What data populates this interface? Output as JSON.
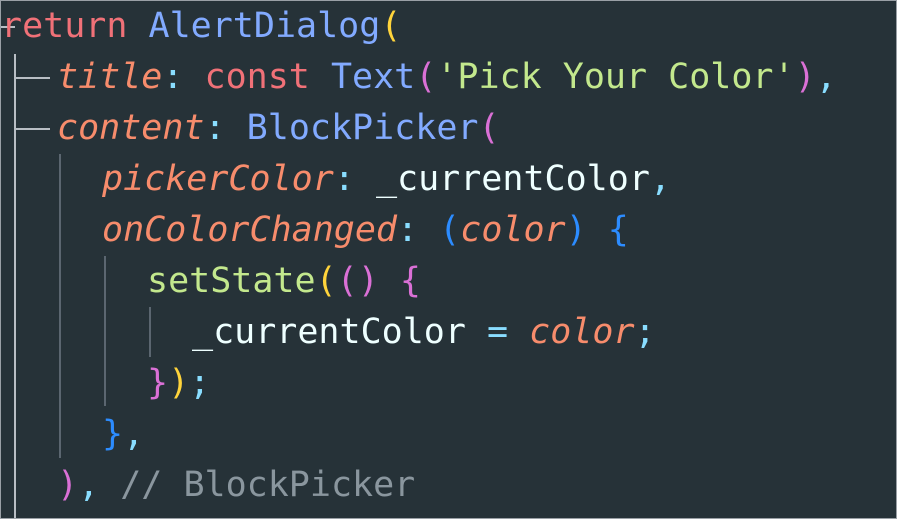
{
  "code": {
    "line1": {
      "keyword": "return",
      "class": "AlertDialog",
      "open": "("
    },
    "line2": {
      "prop": "title",
      "colon": ":",
      "keyword": "const",
      "class": "Text",
      "open": "(",
      "string": "'Pick Your Color'",
      "close": ")",
      "comma": ","
    },
    "line3": {
      "prop": "content",
      "colon": ":",
      "class": "BlockPicker",
      "open": "("
    },
    "line4": {
      "prop": "pickerColor",
      "colon": ":",
      "ident": "_currentColor",
      "comma": ","
    },
    "line5": {
      "prop": "onColorChanged",
      "colon": ":",
      "open": "(",
      "param": "color",
      "close": ")",
      "brace": "{"
    },
    "line6": {
      "fn": "setState",
      "open": "(",
      "open2": "(",
      "close2": ")",
      "brace": "{"
    },
    "line7": {
      "ident": "_currentColor",
      "op": "=",
      "param": "color",
      "semi": ";"
    },
    "line8": {
      "brace": "}",
      "close": ")",
      "semi": ";"
    },
    "line9": {
      "brace": "}",
      "comma": ","
    },
    "line10": {
      "close": ")",
      "comma": ",",
      "comment": "// BlockPicker"
    }
  }
}
